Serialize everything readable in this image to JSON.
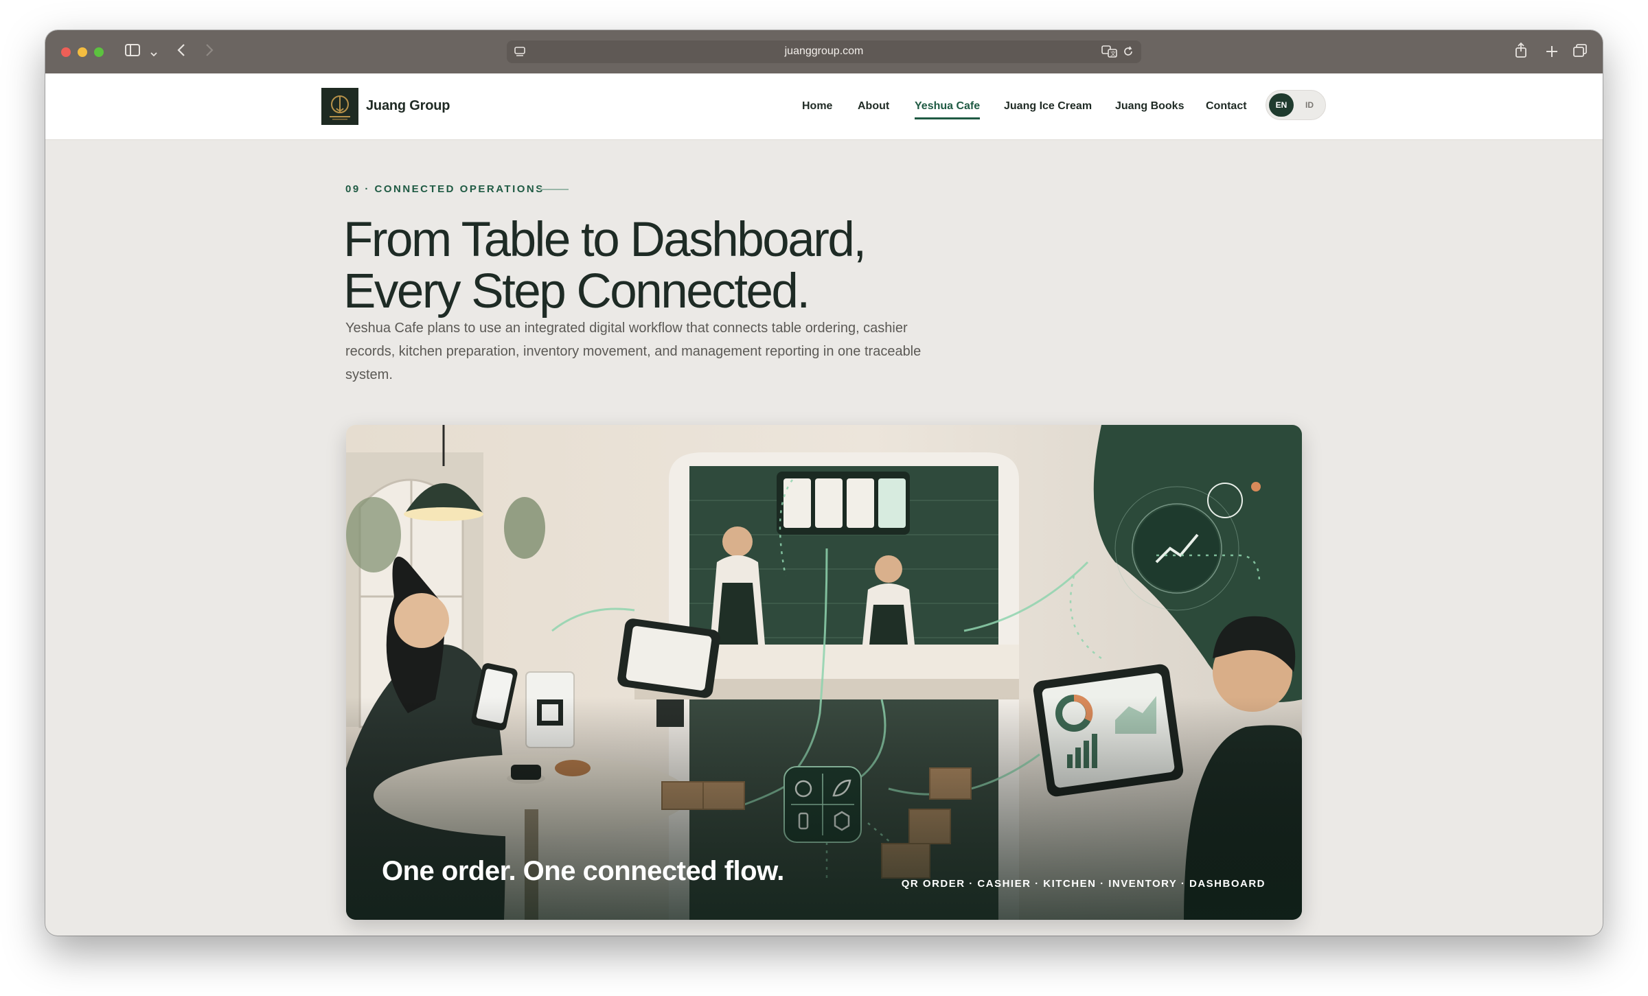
{
  "browser": {
    "url": "juanggroup.com"
  },
  "brand": {
    "name": "Juang Group",
    "logo_alt": "Juang Group logo"
  },
  "nav": {
    "items": [
      {
        "label": "Home"
      },
      {
        "label": "About"
      },
      {
        "label": "Yeshua Cafe",
        "active": true
      },
      {
        "label": "Juang Ice Cream"
      },
      {
        "label": "Juang Books"
      },
      {
        "label": "Contact"
      }
    ],
    "language": {
      "options": [
        "EN",
        "ID"
      ],
      "selected": "EN"
    }
  },
  "section": {
    "eyebrow": "09 · CONNECTED OPERATIONS",
    "title_line1": "From Table to Dashboard,",
    "title_line2": "Every Step Connected.",
    "description": "Yeshua Cafe plans to use an integrated digital workflow that connects table ordering, cashier records, kitchen preparation, inventory movement, and management reporting in one traceable system."
  },
  "illustration": {
    "caption": "One order. One connected flow.",
    "tags": "QR ORDER · CASHIER · KITCHEN · INVENTORY · DASHBOARD"
  },
  "colors": {
    "brand_green": "#1f5a43",
    "dark_green": "#1f3b2e",
    "page_bg": "#ebe9e6",
    "chrome_bg": "#6b6561"
  },
  "icons": [
    "sidebar-icon",
    "chevron-down-icon",
    "back-icon",
    "forward-icon",
    "page-settings-icon",
    "translate-icon",
    "reload-icon",
    "share-icon",
    "new-tab-icon",
    "tab-overview-icon"
  ]
}
